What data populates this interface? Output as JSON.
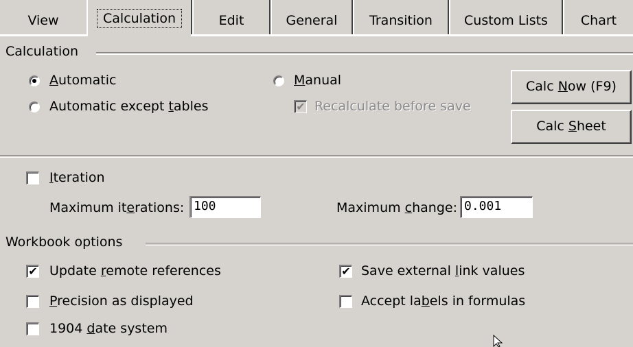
{
  "tabs": [
    {
      "label": "View"
    },
    {
      "label": "Calculation",
      "active": true
    },
    {
      "label": "Edit"
    },
    {
      "label": "General"
    },
    {
      "label": "Transition"
    },
    {
      "label": "Custom Lists"
    },
    {
      "label": "Chart"
    }
  ],
  "calculation": {
    "group_label": "Calculation",
    "automatic": {
      "pre": "",
      "key": "A",
      "post": "utomatic",
      "selected": true
    },
    "automatic_except_tables": {
      "pre": "Automatic except ",
      "key": "t",
      "post": "ables",
      "selected": false
    },
    "manual": {
      "pre": "",
      "key": "M",
      "post": "anual",
      "selected": false
    },
    "recalculate": {
      "label": "Recalculate before save",
      "checked": true,
      "enabled": false
    },
    "calc_now": {
      "pre": "Calc ",
      "key": "N",
      "post": "ow (F9)"
    },
    "calc_sheet": {
      "pre": "Calc ",
      "key": "S",
      "post": "heet"
    }
  },
  "iteration": {
    "checkbox": {
      "pre": "",
      "key": "I",
      "post": "teration",
      "checked": false
    },
    "max_iterations": {
      "pre": "Maximum it",
      "key": "e",
      "post": "rations:",
      "value": "100"
    },
    "max_change": {
      "pre": "Maximum ",
      "key": "c",
      "post": "hange:",
      "value": "0.001"
    }
  },
  "workbook": {
    "group_label": "Workbook options",
    "update_remote": {
      "pre": "Update ",
      "key": "r",
      "post": "emote references",
      "checked": true
    },
    "precision": {
      "pre": "",
      "key": "P",
      "post": "recision as displayed",
      "checked": false
    },
    "date_1904": {
      "pre": "1904 ",
      "key": "d",
      "post": "ate system",
      "checked": false
    },
    "save_external": {
      "pre": "Save external ",
      "key": "l",
      "post": "ink values",
      "checked": true
    },
    "accept_labels": {
      "pre": "Accept la",
      "key": "b",
      "post": "els in formulas",
      "checked": false
    }
  },
  "colors": {
    "dialog_bg": "#d6d3ce",
    "disabled_text": "#8c8a8c"
  }
}
